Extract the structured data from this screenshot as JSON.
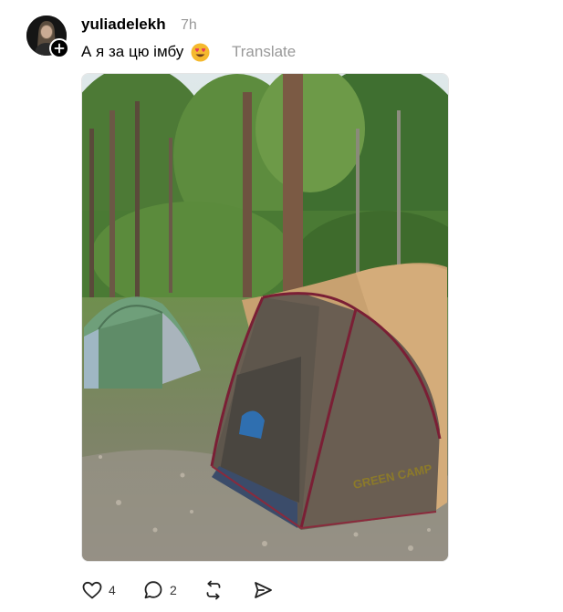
{
  "post": {
    "username": "yuliadelekh",
    "time": "7h",
    "text": "А я за цю імбу",
    "emoji": "smiling-face-with-heart-eyes",
    "translate_label": "Translate"
  },
  "image": {
    "description_icon": "camping-photo",
    "tent_brand": "GREEN CAMP"
  },
  "actions": {
    "like_count": "4",
    "reply_count": "2"
  },
  "icons": [
    "plus-icon",
    "heart-icon",
    "comment-icon",
    "repost-icon",
    "share-icon"
  ]
}
